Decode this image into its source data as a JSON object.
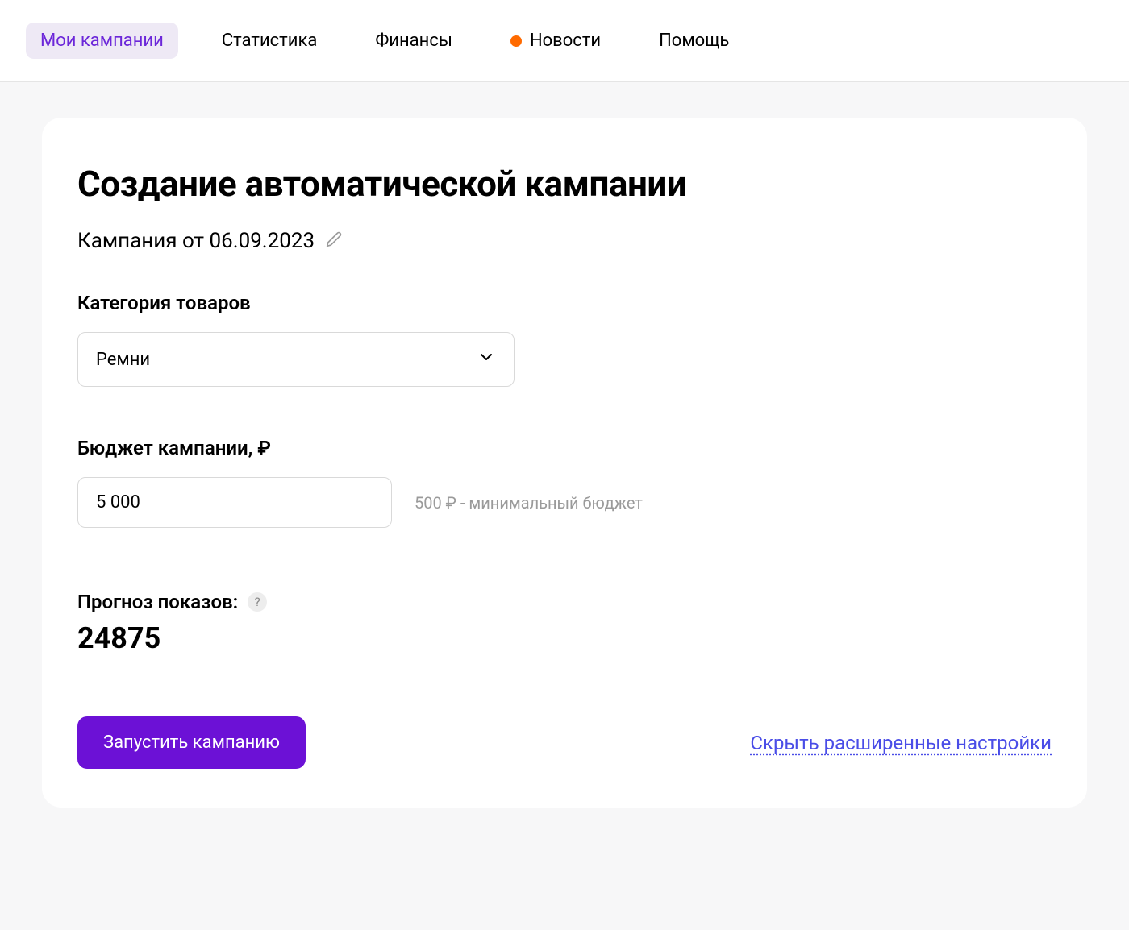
{
  "nav": {
    "items": [
      {
        "label": "Мои кампании",
        "active": true,
        "hasDot": false
      },
      {
        "label": "Статистика",
        "active": false,
        "hasDot": false
      },
      {
        "label": "Финансы",
        "active": false,
        "hasDot": false
      },
      {
        "label": "Новости",
        "active": false,
        "hasDot": true
      },
      {
        "label": "Помощь",
        "active": false,
        "hasDot": false
      }
    ]
  },
  "page": {
    "title": "Создание автоматической кампании",
    "campaign_name": "Кампания от 06.09.2023"
  },
  "category": {
    "label": "Категория товаров",
    "selected": "Ремни"
  },
  "budget": {
    "label": "Бюджет кампании, ₽",
    "value": "5 000",
    "hint": "500 ₽ - минимальный бюджет"
  },
  "forecast": {
    "label": "Прогноз показов:",
    "help": "?",
    "value": "24875"
  },
  "actions": {
    "launch": "Запустить кампанию",
    "toggle_advanced": "Скрыть расширенные настройки"
  }
}
